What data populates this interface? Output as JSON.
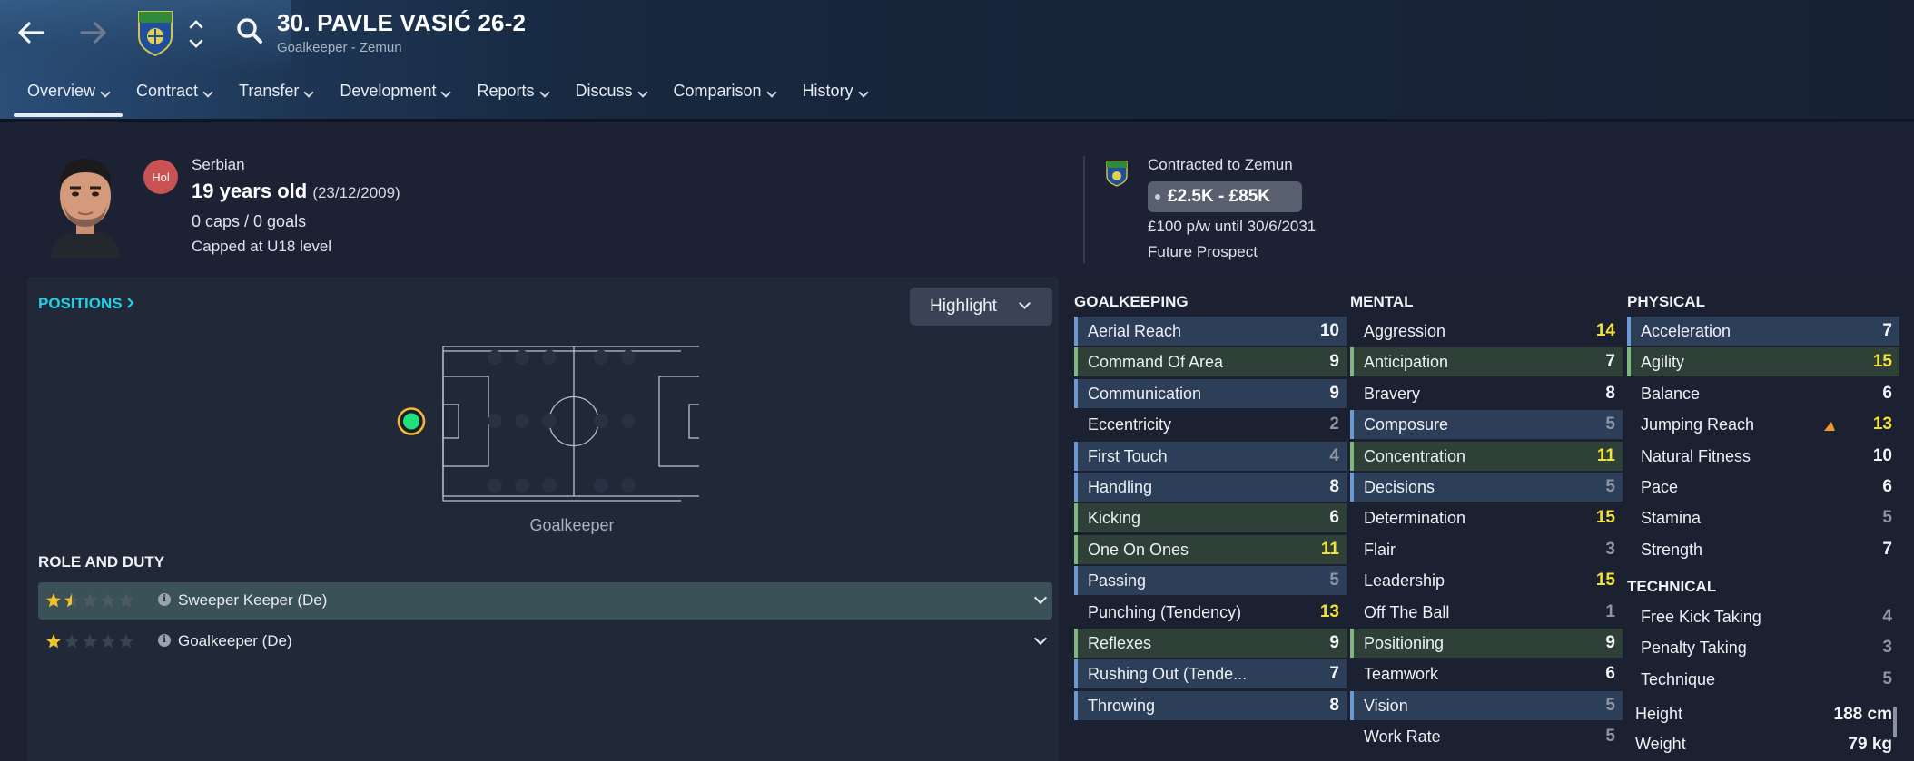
{
  "header": {
    "player_title": "30. PAVLE VASIĆ 26-2",
    "player_subtitle": "Goalkeeper - Zemun",
    "tabs": [
      {
        "label": "Overview",
        "active": true
      },
      {
        "label": "Contract"
      },
      {
        "label": "Transfer"
      },
      {
        "label": "Development"
      },
      {
        "label": "Reports"
      },
      {
        "label": "Discuss"
      },
      {
        "label": "Comparison"
      },
      {
        "label": "History"
      }
    ]
  },
  "profile": {
    "nationality_badge": "Hol",
    "nationality": "Serbian",
    "age": "19 years old",
    "dob": "(23/12/2009)",
    "caps": "0 caps / 0 goals",
    "capped_level": "Capped at U18 level",
    "contracted_to": "Contracted to Zemun",
    "value_range": "£2.5K - £85K",
    "wage": "£100 p/w until 30/6/2031",
    "status": "Future Prospect"
  },
  "positions": {
    "link_label": "POSITIONS",
    "highlight_label": "Highlight",
    "pitch_label": "Goalkeeper",
    "marker_color": "#1fe07a"
  },
  "roles": {
    "title": "ROLE AND DUTY",
    "items": [
      {
        "name": "Sweeper Keeper (De)",
        "stars": 1.5,
        "selected": true
      },
      {
        "name": "Goalkeeper (De)",
        "stars": 1,
        "selected": false
      }
    ]
  },
  "attributes": {
    "goalkeeping": {
      "title": "GOALKEEPING",
      "items": [
        {
          "name": "Aerial Reach",
          "value": "10",
          "hl": "blue",
          "color": "w"
        },
        {
          "name": "Command Of Area",
          "value": "9",
          "hl": "green",
          "color": "w"
        },
        {
          "name": "Communication",
          "value": "9",
          "hl": "blue",
          "color": "w"
        },
        {
          "name": "Eccentricity",
          "value": "2",
          "hl": "none",
          "color": "g"
        },
        {
          "name": "First Touch",
          "value": "4",
          "hl": "blue",
          "color": "g"
        },
        {
          "name": "Handling",
          "value": "8",
          "hl": "blue",
          "color": "w"
        },
        {
          "name": "Kicking",
          "value": "6",
          "hl": "green",
          "color": "w"
        },
        {
          "name": "One On Ones",
          "value": "11",
          "hl": "green",
          "color": "y"
        },
        {
          "name": "Passing",
          "value": "5",
          "hl": "blue",
          "color": "g"
        },
        {
          "name": "Punching (Tendency)",
          "value": "13",
          "hl": "none",
          "color": "y"
        },
        {
          "name": "Reflexes",
          "value": "9",
          "hl": "green",
          "color": "w"
        },
        {
          "name": "Rushing Out (Tende...",
          "value": "7",
          "hl": "blue",
          "color": "w"
        },
        {
          "name": "Throwing",
          "value": "8",
          "hl": "blue",
          "color": "w"
        }
      ]
    },
    "mental": {
      "title": "MENTAL",
      "items": [
        {
          "name": "Aggression",
          "value": "14",
          "hl": "none",
          "color": "y"
        },
        {
          "name": "Anticipation",
          "value": "7",
          "hl": "green",
          "color": "w"
        },
        {
          "name": "Bravery",
          "value": "8",
          "hl": "none",
          "color": "w"
        },
        {
          "name": "Composure",
          "value": "5",
          "hl": "blue",
          "color": "g"
        },
        {
          "name": "Concentration",
          "value": "11",
          "hl": "green",
          "color": "y"
        },
        {
          "name": "Decisions",
          "value": "5",
          "hl": "blue",
          "color": "g"
        },
        {
          "name": "Determination",
          "value": "15",
          "hl": "none",
          "color": "y"
        },
        {
          "name": "Flair",
          "value": "3",
          "hl": "none",
          "color": "g"
        },
        {
          "name": "Leadership",
          "value": "15",
          "hl": "none",
          "color": "y"
        },
        {
          "name": "Off The Ball",
          "value": "1",
          "hl": "none",
          "color": "g"
        },
        {
          "name": "Positioning",
          "value": "9",
          "hl": "green",
          "color": "w"
        },
        {
          "name": "Teamwork",
          "value": "6",
          "hl": "none",
          "color": "w"
        },
        {
          "name": "Vision",
          "value": "5",
          "hl": "blue",
          "color": "g"
        },
        {
          "name": "Work Rate",
          "value": "5",
          "hl": "none",
          "color": "g"
        }
      ]
    },
    "physical": {
      "title": "PHYSICAL",
      "items": [
        {
          "name": "Acceleration",
          "value": "7",
          "hl": "blue",
          "color": "w"
        },
        {
          "name": "Agility",
          "value": "15",
          "hl": "green",
          "color": "y"
        },
        {
          "name": "Balance",
          "value": "6",
          "hl": "none",
          "color": "w"
        },
        {
          "name": "Jumping Reach",
          "value": "13",
          "hl": "none",
          "color": "y"
        },
        {
          "name": "Natural Fitness",
          "value": "10",
          "hl": "none",
          "color": "w"
        },
        {
          "name": "Pace",
          "value": "6",
          "hl": "none",
          "color": "w"
        },
        {
          "name": "Stamina",
          "value": "5",
          "hl": "none",
          "color": "g"
        },
        {
          "name": "Strength",
          "value": "7",
          "hl": "none",
          "color": "w"
        }
      ]
    },
    "technical": {
      "title": "TECHNICAL",
      "items": [
        {
          "name": "Free Kick Taking",
          "value": "4",
          "hl": "none",
          "color": "g"
        },
        {
          "name": "Penalty Taking",
          "value": "3",
          "hl": "none",
          "color": "g"
        },
        {
          "name": "Technique",
          "value": "5",
          "hl": "none",
          "color": "g"
        }
      ]
    },
    "height_label": "Height",
    "height_value": "188 cm",
    "weight_label": "Weight",
    "weight_value": "79 kg"
  },
  "colors": {
    "accent_cyan": "#1ed2e8",
    "high_value_yellow": "#f1e33a",
    "highlight_blue": "#6b9bd6",
    "highlight_green": "#7fb87c"
  }
}
